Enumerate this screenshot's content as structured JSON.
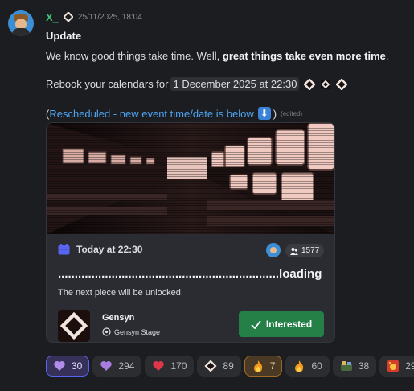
{
  "message": {
    "username": "X_",
    "timestamp": "25/11/2025, 18:04",
    "title": "Update",
    "line1_plain": "We know good things take time. Well, ",
    "line1_bold": "great things take even more time",
    "line1_end": ".",
    "line2_prefix": "Rebook your calendars for",
    "date_chip": "1 December 2025 at 22:30",
    "line3_open": "(",
    "line3_link": "Rescheduled - new event time/date is below",
    "line3_close": ")",
    "edited": "(edited)"
  },
  "event_card": {
    "time": "Today at 22:30",
    "interested_count": "1577",
    "heading": "..................................................................loading",
    "description": "The next piece will be unlocked.",
    "org_name": "Gensyn",
    "org_stage": "Gensyn Stage",
    "interested_label": "Interested",
    "accent_color": "#248046"
  },
  "reactions": [
    {
      "icon": "purple-heart",
      "count": "30"
    },
    {
      "icon": "purple-heart",
      "count": "294"
    },
    {
      "icon": "red-heart",
      "count": "170"
    },
    {
      "icon": "gensyn-hex",
      "count": "89"
    },
    {
      "icon": "fire",
      "count": "7"
    },
    {
      "icon": "fire",
      "count": "60"
    },
    {
      "icon": "custom-emoji",
      "count": "38"
    },
    {
      "icon": "custom-emoji",
      "count": "29"
    }
  ]
}
